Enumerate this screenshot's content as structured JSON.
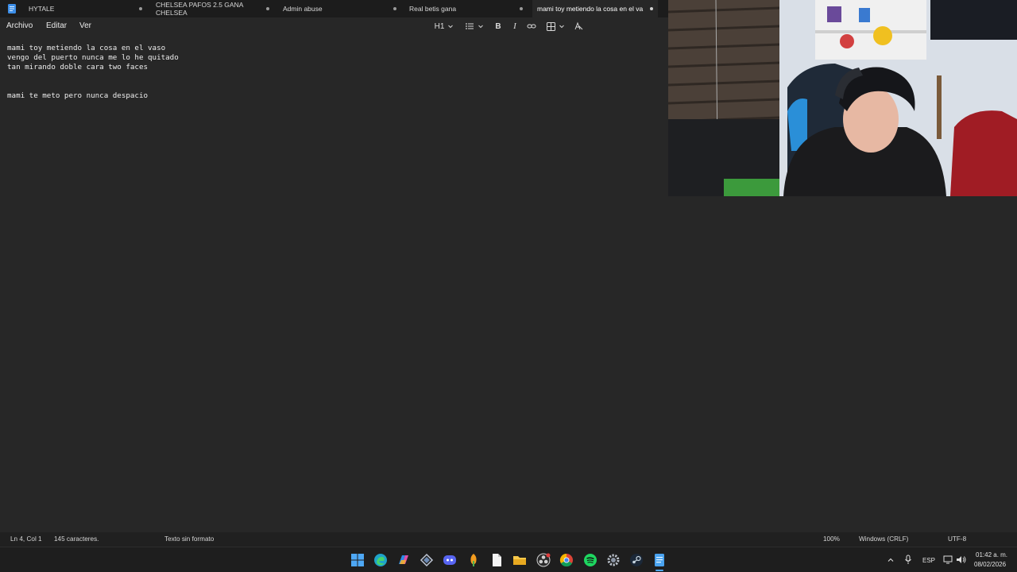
{
  "tabs": [
    {
      "title": "HYTALE"
    },
    {
      "title": "CHELSEA PAFOS 2.5 GANA CHELSEA"
    },
    {
      "title": "Admin abuse"
    },
    {
      "title": "Real betis gana"
    },
    {
      "title": "mami toy metiendo la cosa en el va"
    }
  ],
  "menu": {
    "file": "Archivo",
    "edit": "Editar",
    "view": "Ver"
  },
  "toolbar": {
    "heading": "H1",
    "heading_icon": "chevron-down-icon",
    "list_icon": "list-icon",
    "bold": "B",
    "italic": "I",
    "link_icon": "link-icon",
    "table_icon": "table-icon",
    "clear_format_icon": "clear-format-icon"
  },
  "editor": {
    "lines": [
      "mami toy metiendo la cosa en el vaso",
      "vengo del puerto nunca me lo he quitado",
      "tan mirando doble cara two faces",
      "",
      "",
      "mami te meto pero nunca despacio"
    ]
  },
  "status": {
    "position": "Ln 4, Col 1",
    "chars": "145 caracteres.",
    "format": "Texto sin formato",
    "zoom": "100%",
    "line_ending": "Windows (CRLF)",
    "encoding": "UTF-8"
  },
  "taskbar": {
    "icons": [
      "windows-start-icon",
      "edge-icon",
      "copilot-icon",
      "vpn-icon",
      "discord-icon",
      "fl-studio-icon",
      "file-icon",
      "file-explorer-icon",
      "obs-icon",
      "chrome-icon",
      "spotify-icon",
      "settings-icon",
      "steam-icon",
      "notepad-icon"
    ],
    "tray": {
      "language": "ESP",
      "time": "01:42 a. m.",
      "date": "08/02/2026"
    }
  },
  "colors": {
    "accent": "#0078d4",
    "background": "#272727",
    "tabbar": "#1c1c1c"
  }
}
